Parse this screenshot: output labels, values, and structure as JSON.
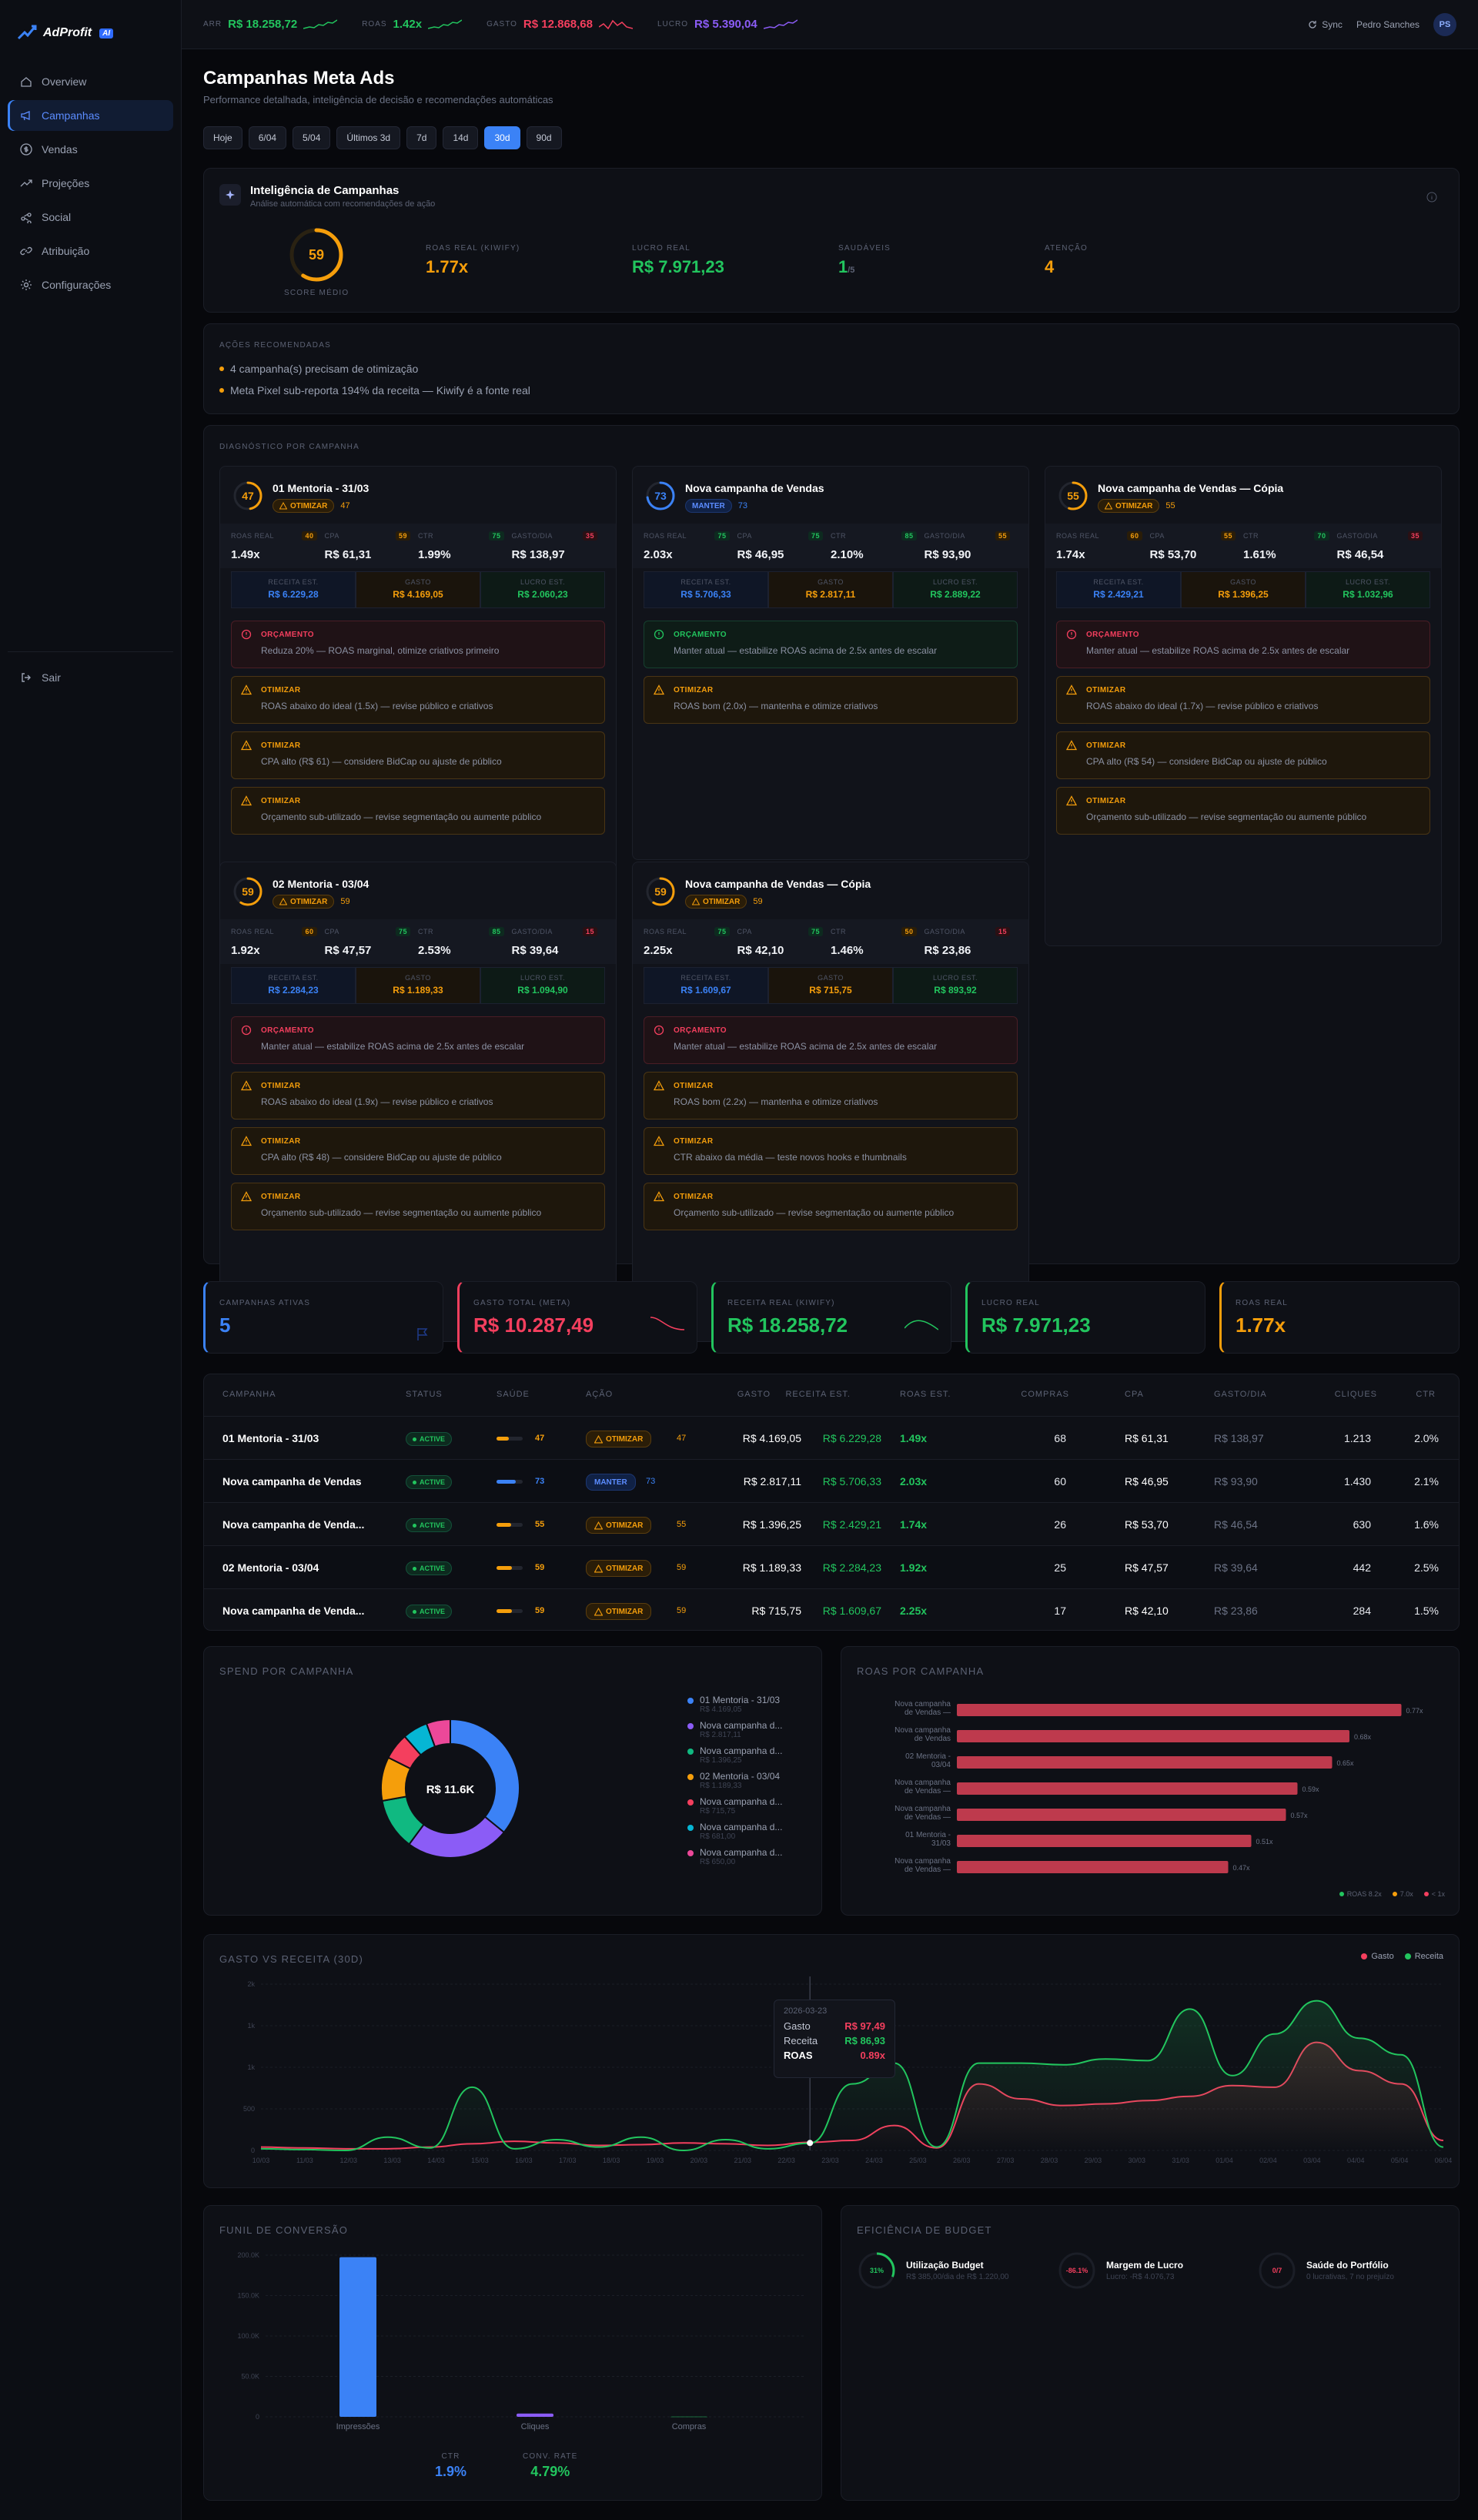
{
  "brand": {
    "name": "AdProfit",
    "tag": "AI"
  },
  "sidebar": {
    "items": [
      {
        "label": "Overview",
        "icon": "home-icon"
      },
      {
        "label": "Campanhas",
        "icon": "megaphone-icon",
        "active": true
      },
      {
        "label": "Vendas",
        "icon": "dollar-icon"
      },
      {
        "label": "Projeções",
        "icon": "trend-icon"
      },
      {
        "label": "Social",
        "icon": "share-icon"
      },
      {
        "label": "Atribuição",
        "icon": "link-icon"
      },
      {
        "label": "Configurações",
        "icon": "settings-icon"
      }
    ],
    "logout": "Sair"
  },
  "topbar": {
    "kpis": [
      {
        "label": "ARR",
        "value": "R$ 18.258,72",
        "color": "#22c55e"
      },
      {
        "label": "ROAS",
        "value": "1.42x",
        "color": "#22c55e"
      },
      {
        "label": "GASTO",
        "value": "R$ 12.868,68",
        "color": "#f43f5e"
      },
      {
        "label": "LUCRO",
        "value": "R$ 5.390,04",
        "color": "#8b5cf6"
      }
    ],
    "sync": "Sync",
    "user": "Pedro Sanches",
    "initials": "PS"
  },
  "header": {
    "title": "Campanhas Meta Ads",
    "subtitle": "Performance detalhada, inteligência de decisão e recomendações automáticas",
    "pills": [
      "Hoje",
      "6/04",
      "5/04",
      "Últimos 3d",
      "7d",
      "14d",
      "30d",
      "90d"
    ],
    "active_pill": "30d"
  },
  "intel": {
    "title": "Inteligência de Campanhas",
    "subtitle": "Análise automática com recomendações de ação",
    "score": "59",
    "score_label": "SCORE MÉDIO",
    "score_fraction": 0.59,
    "metrics": [
      {
        "label": "ROAS REAL (KIWIFY)",
        "value": "1.77x",
        "color": "#f59e0b"
      },
      {
        "label": "LUCRO REAL",
        "value": "R$ 7.971,23",
        "color": "#22c55e"
      },
      {
        "label": "SAUDÁVEIS",
        "value": "1",
        "suffix": "/5",
        "color": "#22c55e"
      },
      {
        "label": "ATENÇÃO",
        "value": "4",
        "color": "#f59e0b"
      }
    ]
  },
  "actions": {
    "title": "AÇÕES RECOMENDADAS",
    "items": [
      "4 campanha(s) precisam de otimização",
      "Meta Pixel sub-reporta 194% da receita — Kiwify é a fonte real"
    ]
  },
  "diagnostic": {
    "title": "DIAGNÓSTICO POR CAMPANHA",
    "metric_labels": [
      "ROAS REAL",
      "CPA",
      "CTR",
      "GASTO/DIA"
    ],
    "fin_labels": [
      "RECEITA EST.",
      "GASTO",
      "LUCRO EST."
    ],
    "campaigns": [
      {
        "name": "01 Mentoria - 31/03",
        "score": "47",
        "score_n": 47,
        "badge": "OTIMIZAR",
        "badge_kind": "opt",
        "metrics": [
          {
            "v": "1.49x",
            "s": "40"
          },
          {
            "v": "R$ 61,31",
            "s": "59"
          },
          {
            "v": "1.99%",
            "s": "75"
          },
          {
            "v": "R$ 138,97",
            "s": "35"
          }
        ],
        "fin": [
          "R$ 6.229,28",
          "R$ 4.169,05",
          "R$ 2.060,23"
        ],
        "recs": [
          {
            "kind": "red",
            "title": "ORÇAMENTO",
            "text": "Reduza 20% — ROAS marginal, otimize criativos primeiro"
          },
          {
            "kind": "amb",
            "title": "OTIMIZAR",
            "text": "ROAS abaixo do ideal (1.5x) — revise público e criativos"
          },
          {
            "kind": "amb",
            "title": "OTIMIZAR",
            "text": "CPA alto (R$ 61) — considere BidCap ou ajuste de público"
          },
          {
            "kind": "amb",
            "title": "OTIMIZAR",
            "text": "Orçamento sub-utilizado — revise segmentação ou aumente público"
          }
        ]
      },
      {
        "name": "Nova campanha de Vendas",
        "score": "73",
        "score_n": 73,
        "badge": "MANTER",
        "badge_kind": "man",
        "metrics": [
          {
            "v": "2.03x",
            "s": "75"
          },
          {
            "v": "R$ 46,95",
            "s": "75"
          },
          {
            "v": "2.10%",
            "s": "85"
          },
          {
            "v": "R$ 93,90",
            "s": "55"
          }
        ],
        "fin": [
          "R$ 5.706,33",
          "R$ 2.817,11",
          "R$ 2.889,22"
        ],
        "recs": [
          {
            "kind": "grn",
            "title": "ORÇAMENTO",
            "text": "Manter atual — estabilize ROAS acima de 2.5x antes de escalar"
          },
          {
            "kind": "amb",
            "title": "OTIMIZAR",
            "text": "ROAS bom (2.0x) — mantenha e otimize criativos"
          }
        ]
      },
      {
        "name": "Nova campanha de Vendas — Cópia",
        "score": "55",
        "score_n": 55,
        "badge": "OTIMIZAR",
        "badge_kind": "opt",
        "metrics": [
          {
            "v": "1.74x",
            "s": "60"
          },
          {
            "v": "R$ 53,70",
            "s": "55"
          },
          {
            "v": "1.61%",
            "s": "70"
          },
          {
            "v": "R$ 46,54",
            "s": "35"
          }
        ],
        "fin": [
          "R$ 2.429,21",
          "R$ 1.396,25",
          "R$ 1.032,96"
        ],
        "recs": [
          {
            "kind": "red",
            "title": "ORÇAMENTO",
            "text": "Manter atual — estabilize ROAS acima de 2.5x antes de escalar"
          },
          {
            "kind": "amb",
            "title": "OTIMIZAR",
            "text": "ROAS abaixo do ideal (1.7x) — revise público e criativos"
          },
          {
            "kind": "amb",
            "title": "OTIMIZAR",
            "text": "CPA alto (R$ 54) — considere BidCap ou ajuste de público"
          },
          {
            "kind": "amb",
            "title": "OTIMIZAR",
            "text": "Orçamento sub-utilizado — revise segmentação ou aumente público"
          }
        ]
      },
      {
        "name": "02 Mentoria - 03/04",
        "score": "59",
        "score_n": 59,
        "badge": "OTIMIZAR",
        "badge_kind": "opt",
        "metrics": [
          {
            "v": "1.92x",
            "s": "60"
          },
          {
            "v": "R$ 47,57",
            "s": "75"
          },
          {
            "v": "2.53%",
            "s": "85"
          },
          {
            "v": "R$ 39,64",
            "s": "15"
          }
        ],
        "fin": [
          "R$ 2.284,23",
          "R$ 1.189,33",
          "R$ 1.094,90"
        ],
        "recs": [
          {
            "kind": "red",
            "title": "ORÇAMENTO",
            "text": "Manter atual — estabilize ROAS acima de 2.5x antes de escalar"
          },
          {
            "kind": "amb",
            "title": "OTIMIZAR",
            "text": "ROAS abaixo do ideal (1.9x) — revise público e criativos"
          },
          {
            "kind": "amb",
            "title": "OTIMIZAR",
            "text": "CPA alto (R$ 48) — considere BidCap ou ajuste de público"
          },
          {
            "kind": "amb",
            "title": "OTIMIZAR",
            "text": "Orçamento sub-utilizado — revise segmentação ou aumente público"
          }
        ]
      },
      {
        "name": "Nova campanha de Vendas — Cópia",
        "score": "59",
        "score_n": 59,
        "badge": "OTIMIZAR",
        "badge_kind": "opt",
        "metrics": [
          {
            "v": "2.25x",
            "s": "75"
          },
          {
            "v": "R$ 42,10",
            "s": "75"
          },
          {
            "v": "1.46%",
            "s": "50"
          },
          {
            "v": "R$ 23,86",
            "s": "15"
          }
        ],
        "fin": [
          "R$ 1.609,67",
          "R$ 715,75",
          "R$ 893,92"
        ],
        "recs": [
          {
            "kind": "red",
            "title": "ORÇAMENTO",
            "text": "Manter atual — estabilize ROAS acima de 2.5x antes de escalar"
          },
          {
            "kind": "amb",
            "title": "OTIMIZAR",
            "text": "ROAS bom (2.2x) — mantenha e otimize criativos"
          },
          {
            "kind": "amb",
            "title": "OTIMIZAR",
            "text": "CTR abaixo da média — teste novos hooks e thumbnails"
          },
          {
            "kind": "amb",
            "title": "OTIMIZAR",
            "text": "Orçamento sub-utilizado — revise segmentação ou aumente público"
          }
        ]
      }
    ]
  },
  "stats": [
    {
      "label": "CAMPANHAS ATIVAS",
      "value": "5",
      "color": "#3b82f6"
    },
    {
      "label": "GASTO TOTAL (META)",
      "value": "R$ 10.287,49",
      "color": "#f43f5e"
    },
    {
      "label": "RECEITA REAL (KIWIFY)",
      "value": "R$ 18.258,72",
      "color": "#22c55e"
    },
    {
      "label": "LUCRO REAL",
      "value": "R$ 7.971,23",
      "color": "#22c55e"
    },
    {
      "label": "ROAS REAL",
      "value": "1.77x",
      "color": "#f59e0b"
    }
  ],
  "table": {
    "headers": [
      "CAMPANHA",
      "STATUS",
      "SAÚDE",
      "AÇÃO",
      "GASTO",
      "RECEITA EST.",
      "ROAS EST.",
      "COMPRAS",
      "CPA",
      "GASTO/DIA",
      "CLIQUES",
      "CTR"
    ],
    "rows": [
      {
        "name": "01 Mentoria - 31/03",
        "status": "ACTIVE",
        "health": "47",
        "health_n": 47,
        "action": "OTIMIZAR",
        "action_kind": "opt",
        "action_score": "47",
        "gasto": "R$ 4.169,05",
        "receita": "R$ 6.229,28",
        "roas": "1.49x",
        "compras": "68",
        "cpa": "R$ 61,31",
        "gdia": "R$ 138,97",
        "cliques": "1.213",
        "ctr": "2.0%"
      },
      {
        "name": "Nova campanha de Vendas",
        "status": "ACTIVE",
        "health": "73",
        "health_n": 73,
        "action": "MANTER",
        "action_kind": "man",
        "action_score": "73",
        "gasto": "R$ 2.817,11",
        "receita": "R$ 5.706,33",
        "roas": "2.03x",
        "compras": "60",
        "cpa": "R$ 46,95",
        "gdia": "R$ 93,90",
        "cliques": "1.430",
        "ctr": "2.1%"
      },
      {
        "name": "Nova campanha de Venda...",
        "status": "ACTIVE",
        "health": "55",
        "health_n": 55,
        "action": "OTIMIZAR",
        "action_kind": "opt",
        "action_score": "55",
        "gasto": "R$ 1.396,25",
        "receita": "R$ 2.429,21",
        "roas": "1.74x",
        "compras": "26",
        "cpa": "R$ 53,70",
        "gdia": "R$ 46,54",
        "cliques": "630",
        "ctr": "1.6%"
      },
      {
        "name": "02 Mentoria - 03/04",
        "status": "ACTIVE",
        "health": "59",
        "health_n": 59,
        "action": "OTIMIZAR",
        "action_kind": "opt",
        "action_score": "59",
        "gasto": "R$ 1.189,33",
        "receita": "R$ 2.284,23",
        "roas": "1.92x",
        "compras": "25",
        "cpa": "R$ 47,57",
        "gdia": "R$ 39,64",
        "cliques": "442",
        "ctr": "2.5%"
      },
      {
        "name": "Nova campanha de Venda...",
        "status": "ACTIVE",
        "health": "59",
        "health_n": 59,
        "action": "OTIMIZAR",
        "action_kind": "opt",
        "action_score": "59",
        "gasto": "R$ 715,75",
        "receita": "R$ 1.609,67",
        "roas": "2.25x",
        "compras": "17",
        "cpa": "R$ 42,10",
        "gdia": "R$ 23,86",
        "cliques": "284",
        "ctr": "1.5%"
      }
    ]
  },
  "spend_chart": {
    "title": "SPEND POR CAMPANHA",
    "center": "R$ 11.6K"
  },
  "roas_chart": {
    "title": "ROAS POR CAMPANHA",
    "legend": [
      "ROAS 8.2x",
      "7.0x",
      "< 1x"
    ]
  },
  "line_chart": {
    "title": "GASTO VS RECEITA (30D)",
    "legend": [
      "Gasto",
      "Receita"
    ],
    "tooltip": {
      "date": "2026-03-23",
      "gasto_label": "Gasto",
      "gasto": "R$ 97,49",
      "receita_label": "Receita",
      "receita": "R$ 86,93",
      "roas_label": "ROAS",
      "roas": "0.89x"
    }
  },
  "funnel": {
    "title": "FUNIL DE CONVERSÃO",
    "ctr_label": "CTR",
    "ctr": "1.9%",
    "conv_label": "CONV. RATE",
    "conv": "4.79%"
  },
  "budget": {
    "title": "EFICIÊNCIA DE BUDGET",
    "items": [
      {
        "ring": "31%",
        "ring_frac": 0.31,
        "color": "#22c55e",
        "title": "Utilização Budget",
        "sub": "R$ 385,00/dia de R$ 1.220,00"
      },
      {
        "ring": "-86.1%",
        "ring_frac": 0.0,
        "color": "#f43f5e",
        "title": "Margem de Lucro",
        "sub": "Lucro: -R$ 4.076,73"
      },
      {
        "ring": "0/7",
        "ring_frac": 0.0,
        "color": "#f43f5e",
        "title": "Saúde do Portfólio",
        "sub": "0 lucrativas, 7 no prejuízo"
      }
    ]
  },
  "chart_data": [
    {
      "type": "pie",
      "title": "SPEND POR CAMPANHA",
      "categories": [
        "01 Mentoria - 31/03",
        "Nova campanha d...",
        "Nova campanha d...",
        "02 Mentoria - 03/04",
        "Nova campanha d...",
        "Nova campanha d...",
        "Nova campanha d..."
      ],
      "sub": [
        "R$ 4.169,05",
        "R$ 2.817,11",
        "R$ 1.396,25",
        "R$ 1.189,33",
        "R$ 715,75",
        "R$ 681,00",
        "R$ 650,00"
      ],
      "values": [
        4169.05,
        2817.11,
        1396.25,
        1189.33,
        715.75,
        681.0,
        650.0
      ],
      "colors": [
        "#3b82f6",
        "#8b5cf6",
        "#10b981",
        "#f59e0b",
        "#f43f5e",
        "#06b6d4",
        "#ec4899"
      ]
    },
    {
      "type": "bar",
      "title": "ROAS POR CAMPANHA",
      "categories": [
        "Nova campanha de Vendas —",
        "Nova campanha de Vendas",
        "02 Mentoria - 03/04",
        "Nova campanha de Vendas —",
        "Nova campanha de Vendas —",
        "01 Mentoria - 31/03",
        "Nova campanha de Vendas —"
      ],
      "values": [
        0.77,
        0.68,
        0.65,
        0.59,
        0.57,
        0.51,
        0.47
      ],
      "labels": [
        "0.77x",
        "0.68x",
        "0.65x",
        "0.59x",
        "0.57x",
        "0.51x",
        "0.47x"
      ],
      "xlim": [
        0,
        0.8
      ]
    },
    {
      "type": "line",
      "title": "GASTO VS RECEITA (30D)",
      "x": [
        "10/03",
        "11/03",
        "12/03",
        "13/03",
        "14/03",
        "15/03",
        "16/03",
        "17/03",
        "18/03",
        "19/03",
        "20/03",
        "21/03",
        "22/03",
        "23/03",
        "24/03",
        "25/03",
        "26/03",
        "27/03",
        "28/03",
        "29/03",
        "30/03",
        "31/03",
        "01/04",
        "02/04",
        "03/04",
        "04/04",
        "05/04",
        "06/04"
      ],
      "ylim": [
        0,
        2000
      ],
      "yticks": [
        "0",
        "500",
        "1k",
        "1k",
        "2k"
      ],
      "series": [
        {
          "name": "Gasto",
          "color": "#f43f5e",
          "values": [
            40,
            30,
            20,
            20,
            40,
            80,
            110,
            90,
            60,
            70,
            90,
            80,
            60,
            97,
            120,
            300,
            30,
            800,
            620,
            540,
            560,
            600,
            650,
            780,
            760,
            1300,
            960,
            800,
            120
          ]
        },
        {
          "name": "Receita",
          "color": "#22c55e",
          "values": [
            20,
            10,
            0,
            160,
            30,
            760,
            20,
            130,
            40,
            160,
            0,
            130,
            20,
            87,
            800,
            1050,
            40,
            1050,
            1050,
            1030,
            1100,
            1080,
            1700,
            900,
            1400,
            1800,
            1350,
            1150,
            40
          ]
        }
      ]
    },
    {
      "type": "bar",
      "title": "FUNIL DE CONVERSÃO",
      "categories": [
        "Impressões",
        "Cliques",
        "Compras"
      ],
      "values": [
        197500,
        3999,
        196
      ],
      "yticks": [
        "0",
        "50.0K",
        "100.0K",
        "150.0K",
        "200.0K"
      ],
      "ylim": [
        0,
        200000
      ]
    }
  ]
}
